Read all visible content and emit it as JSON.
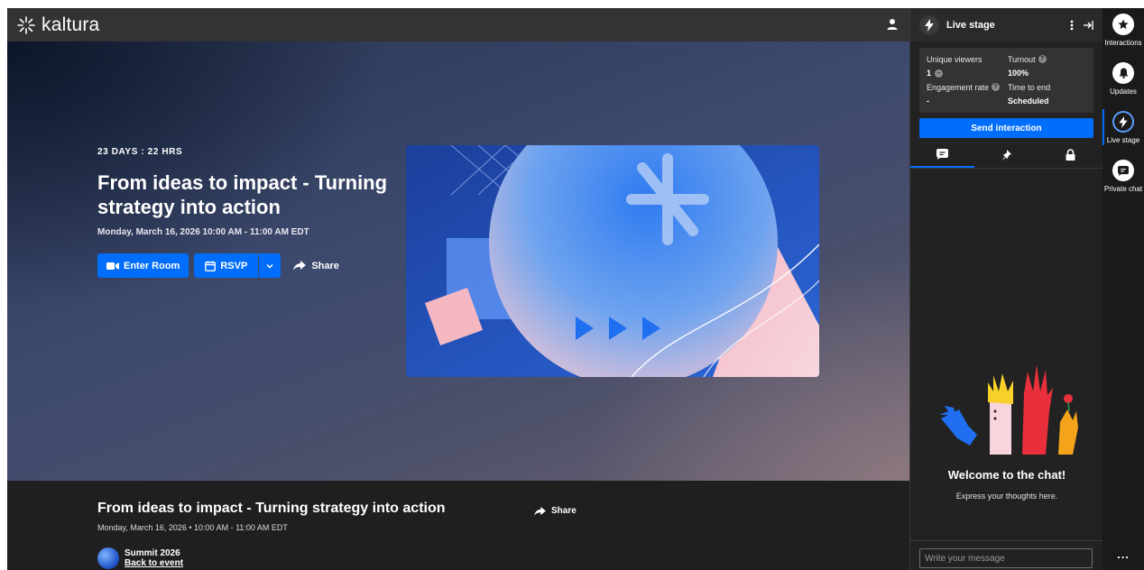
{
  "header": {
    "logo_text": "kaltura"
  },
  "hero": {
    "countdown": "23 DAYS : 22 HRS",
    "title": "From ideas to impact - Turning strategy into action",
    "datetime": "Monday, March 16, 2026  10:00 AM - 11:00 AM EDT",
    "enter_label": "Enter Room",
    "rsvp_label": "RSVP",
    "share_label": "Share"
  },
  "info": {
    "title": "From ideas to impact - Turning strategy into action",
    "datetime": "Monday, March 16, 2026  •  10:00 AM - 11:00 AM EDT",
    "share_label": "Share",
    "org_name": "Summit 2026",
    "back_link": "Back to event"
  },
  "panel": {
    "title": "Live stage",
    "stats": {
      "unique_viewers_label": "Unique viewers",
      "unique_viewers_value": "1",
      "turnout_label": "Turnout",
      "turnout_value": "100%",
      "engagement_label": "Engagement rate",
      "engagement_value": "-",
      "time_to_end_label": "Time to end",
      "time_to_end_value": "Scheduled"
    },
    "send_interaction": "Send interaction",
    "chat": {
      "welcome": "Welcome to the chat!",
      "subtitle": "Express your thoughts here.",
      "placeholder": "Write your message"
    }
  },
  "rail": {
    "items": [
      {
        "label": "Interactions",
        "icon": "star-icon"
      },
      {
        "label": "Updates",
        "icon": "bell-icon"
      },
      {
        "label": "Live stage",
        "icon": "bolt-icon"
      },
      {
        "label": "Private chat",
        "icon": "chat-icon"
      }
    ],
    "more": "..."
  },
  "colors": {
    "accent": "#006efa",
    "panel_bg": "#222222",
    "header_bg": "#333334"
  }
}
